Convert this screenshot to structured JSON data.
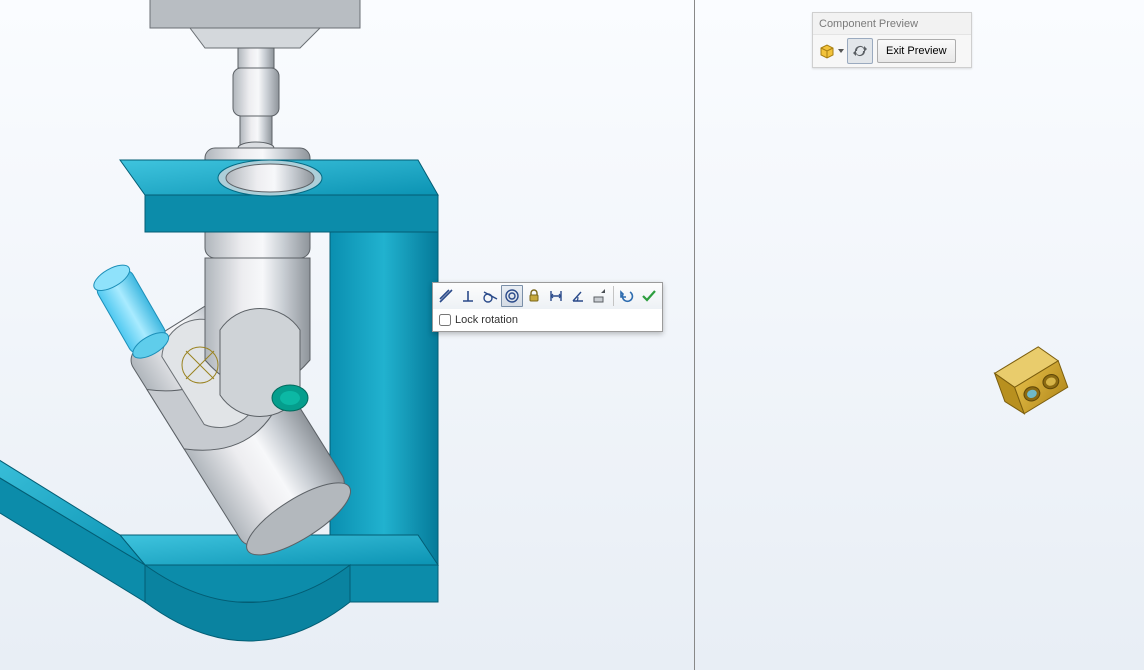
{
  "preview_panel": {
    "title": "Component Preview",
    "exit_button_label": "Exit Preview"
  },
  "mate_toolbar": {
    "lock_rotation_label": "Lock rotation",
    "lock_rotation_checked": false,
    "buttons": [
      {
        "name": "coincident-mate-icon"
      },
      {
        "name": "perpendicular-mate-icon"
      },
      {
        "name": "tangent-mate-icon"
      },
      {
        "name": "concentric-mate-icon",
        "selected": true
      },
      {
        "name": "lock-mate-icon"
      },
      {
        "name": "distance-mate-icon"
      },
      {
        "name": "angle-mate-icon"
      },
      {
        "name": "flip-mate-alignment-icon"
      },
      {
        "name": "undo-icon"
      },
      {
        "name": "ok-icon"
      }
    ]
  },
  "icons": {
    "component_box": "component-box-icon",
    "sync": "sync-icon"
  }
}
